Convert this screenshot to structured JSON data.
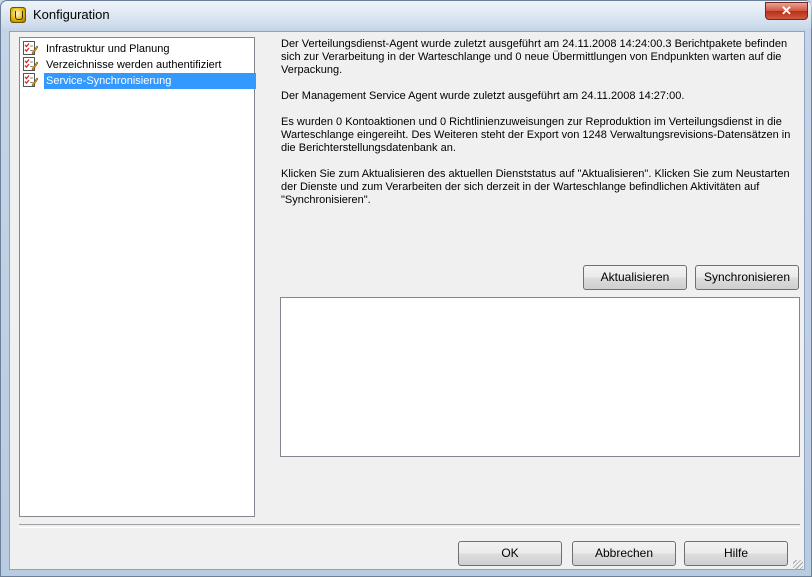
{
  "window": {
    "title": "Konfiguration",
    "close_glyph": "✕"
  },
  "tree": {
    "items": [
      {
        "label": "Infrastruktur und Planung",
        "icon": "checklist-edit-icon",
        "selected": false
      },
      {
        "label": "Verzeichnisse werden authentifiziert",
        "icon": "checklist-edit-icon",
        "selected": false
      },
      {
        "label": "Service-Synchronisierung",
        "icon": "checklist-edit-icon",
        "selected": true
      }
    ]
  },
  "status": {
    "distribution_agent": "Der Verteilungsdienst-Agent wurde zuletzt ausgeführt am 24.11.2008 14:24:00.3 Berichtpakete befinden sich zur Verarbeitung in der Warteschlange und 0 neue Übermittlungen von Endpunkten warten auf die Verpackung.",
    "management_agent": "Der Management Service Agent wurde zuletzt ausgeführt am 24.11.2008 14:27:00.",
    "queue_info": "Es wurden 0 Kontoaktionen und 0 Richtlinienzuweisungen zur Reproduktion im Verteilungsdienst in die Warteschlange eingereiht. Des Weiteren steht der Export von 1248 Verwaltungsrevisions-Datensätzen in die Berichterstellungsdatenbank an.",
    "instructions": "Klicken Sie zum Aktualisieren des aktuellen Dienststatus auf \"Aktualisieren\". Klicken Sie zum Neustarten der Dienste und zum Verarbeiten der sich derzeit in der Warteschlange befindlichen Aktivitäten auf \"Synchronisieren\"."
  },
  "actions": {
    "refresh_label": "Aktualisieren",
    "sync_label": "Synchronisieren"
  },
  "log": {
    "content": ""
  },
  "footer": {
    "ok_label": "OK",
    "cancel_label": "Abbrechen",
    "help_label": "Hilfe"
  },
  "colors": {
    "selection": "#3399ff",
    "close_button": "#c8492f"
  }
}
